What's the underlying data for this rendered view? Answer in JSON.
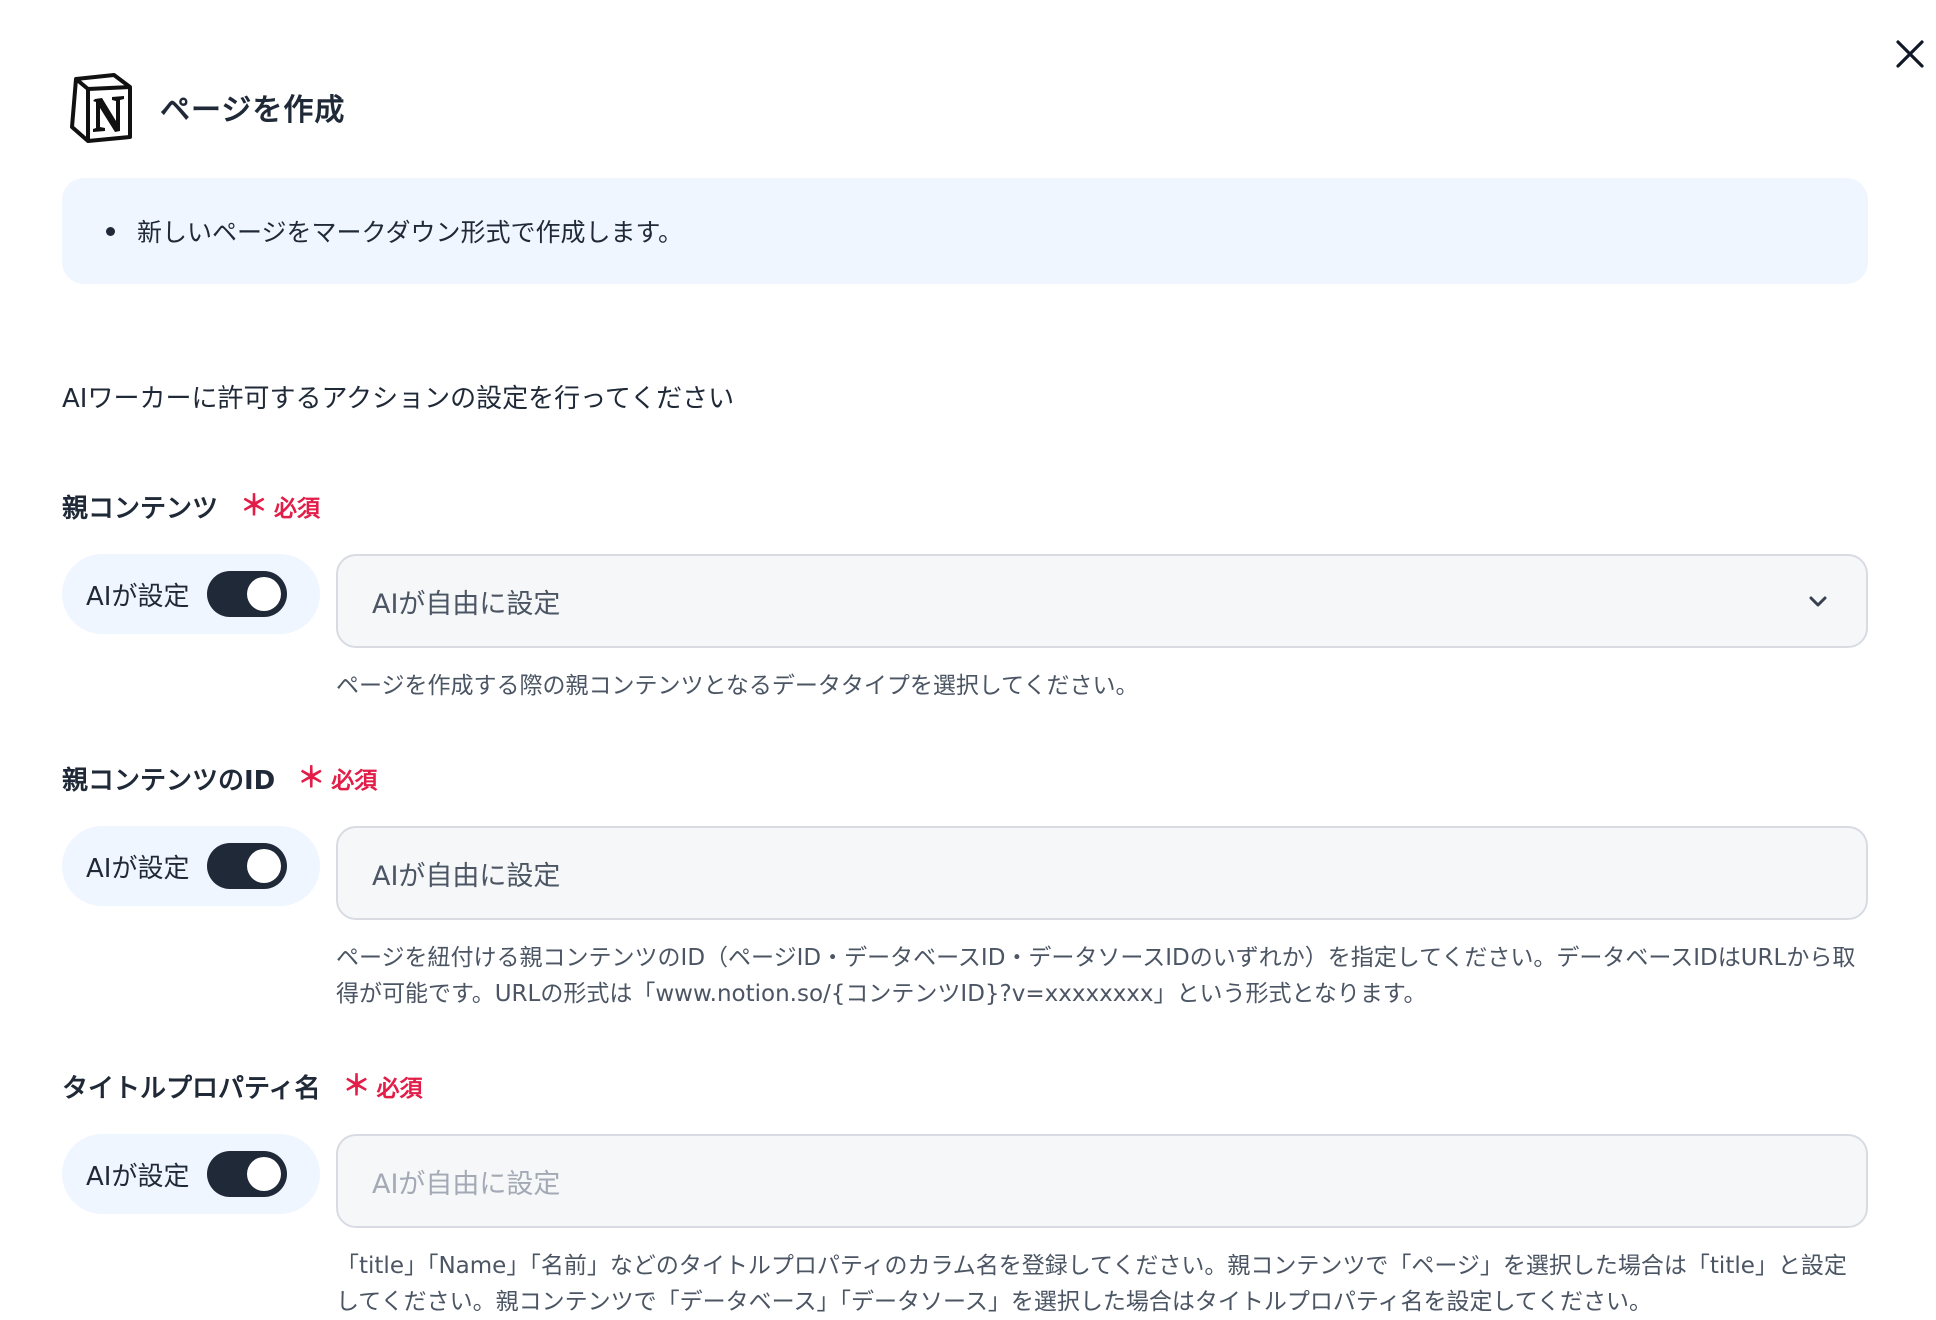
{
  "header": {
    "title": "ページを作成"
  },
  "info": {
    "bullet": "新しいページをマークダウン形式で作成します。"
  },
  "instruction": "AIワーカーに許可するアクションの設定を行ってください",
  "required_label": "必須",
  "required_star": "＊",
  "fields": [
    {
      "label": "親コンテンツ",
      "ai_label": "AIが設定",
      "toggle_on": true,
      "input_value": "AIが自由に設定",
      "input_type": "select",
      "help": "ページを作成する際の親コンテンツとなるデータタイプを選択してください。"
    },
    {
      "label": "親コンテンツのID",
      "ai_label": "AIが設定",
      "toggle_on": true,
      "input_value": "AIが自由に設定",
      "input_type": "text",
      "help": "ページを紐付ける親コンテンツのID（ページID・データベースID・データソースIDのいずれか）を指定してください。データベースIDはURLから取得が可能です。URLの形式は「www.notion.so/{コンテンツID}?v=xxxxxxxx」という形式となります。"
    },
    {
      "label": "タイトルプロパティ名",
      "ai_label": "AIが設定",
      "toggle_on": true,
      "input_placeholder": "AIが自由に設定",
      "input_type": "text",
      "help": "「title」「Name」「名前」などのタイトルプロパティのカラム名を登録してください。親コンテンツで「ページ」を選択した場合は「title」と設定してください。親コンテンツで「データベース」「データソース」を選択した場合はタイトルプロパティ名を設定してください。"
    }
  ],
  "icons": {
    "close": "close-icon",
    "logo": "notion-logo",
    "chevron": "chevron-down-icon"
  },
  "colors": {
    "accent_bg": "#f0f6ff",
    "toggle_on": "#1f2937",
    "required": "#e11d48"
  }
}
